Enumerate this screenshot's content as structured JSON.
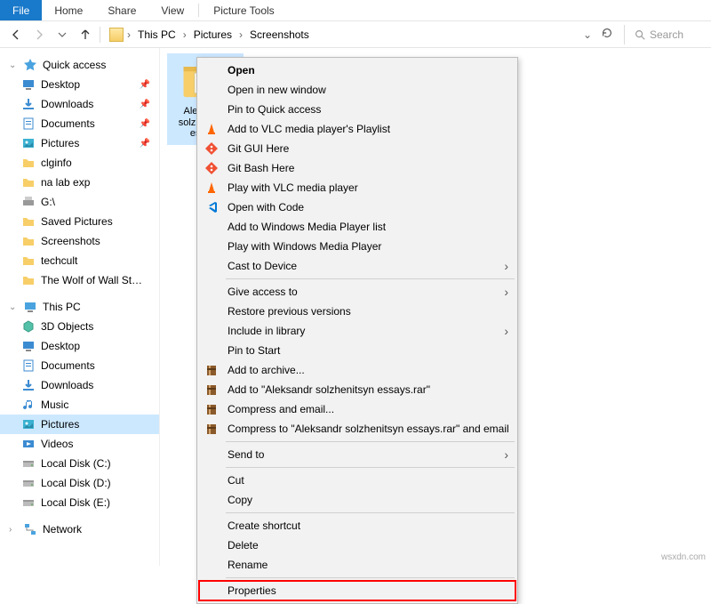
{
  "ribbon": {
    "file": "File",
    "home": "Home",
    "share": "Share",
    "view": "View",
    "tools": "Picture Tools"
  },
  "nav": {
    "crumbs": [
      "This PC",
      "Pictures",
      "Screenshots"
    ],
    "search_placeholder": "Search"
  },
  "sidebar": {
    "quick_access": "Quick access",
    "qa_items": [
      {
        "label": "Desktop",
        "icon": "desktop",
        "pinned": true
      },
      {
        "label": "Downloads",
        "icon": "downloads",
        "pinned": true
      },
      {
        "label": "Documents",
        "icon": "documents",
        "pinned": true
      },
      {
        "label": "Pictures",
        "icon": "pictures",
        "pinned": true
      },
      {
        "label": "clginfo",
        "icon": "folder",
        "pinned": false
      },
      {
        "label": "na lab exp",
        "icon": "folder",
        "pinned": false
      },
      {
        "label": "G:\\",
        "icon": "drive-removable",
        "pinned": false
      },
      {
        "label": "Saved Pictures",
        "icon": "folder",
        "pinned": false
      },
      {
        "label": "Screenshots",
        "icon": "folder",
        "pinned": false
      },
      {
        "label": "techcult",
        "icon": "folder",
        "pinned": false
      },
      {
        "label": "The Wolf of Wall St…",
        "icon": "folder",
        "pinned": false
      }
    ],
    "this_pc": "This PC",
    "pc_items": [
      {
        "label": "3D Objects",
        "icon": "3d"
      },
      {
        "label": "Desktop",
        "icon": "desktop"
      },
      {
        "label": "Documents",
        "icon": "documents"
      },
      {
        "label": "Downloads",
        "icon": "downloads"
      },
      {
        "label": "Music",
        "icon": "music"
      },
      {
        "label": "Pictures",
        "icon": "pictures",
        "selected": true
      },
      {
        "label": "Videos",
        "icon": "videos"
      },
      {
        "label": "Local Disk (C:)",
        "icon": "drive"
      },
      {
        "label": "Local Disk (D:)",
        "icon": "drive"
      },
      {
        "label": "Local Disk (E:)",
        "icon": "drive"
      }
    ],
    "network": "Network"
  },
  "content": {
    "selected_folder": "Aleksandr solzhenitsyn essays"
  },
  "context_menu": {
    "groups": [
      [
        {
          "label": "Open",
          "bold": true
        },
        {
          "label": "Open in new window"
        },
        {
          "label": "Pin to Quick access"
        },
        {
          "label": "Add to VLC media player's Playlist",
          "icon": "vlc"
        },
        {
          "label": "Git GUI Here",
          "icon": "git"
        },
        {
          "label": "Git Bash Here",
          "icon": "git"
        },
        {
          "label": "Play with VLC media player",
          "icon": "vlc"
        },
        {
          "label": "Open with Code",
          "icon": "vscode"
        },
        {
          "label": "Add to Windows Media Player list"
        },
        {
          "label": "Play with Windows Media Player"
        },
        {
          "label": "Cast to Device",
          "submenu": true
        }
      ],
      [
        {
          "label": "Give access to",
          "submenu": true
        },
        {
          "label": "Restore previous versions"
        },
        {
          "label": "Include in library",
          "submenu": true
        },
        {
          "label": "Pin to Start"
        },
        {
          "label": "Add to archive...",
          "icon": "rar"
        },
        {
          "label": "Add to \"Aleksandr solzhenitsyn essays.rar\"",
          "icon": "rar"
        },
        {
          "label": "Compress and email...",
          "icon": "rar"
        },
        {
          "label": "Compress to \"Aleksandr solzhenitsyn essays.rar\" and email",
          "icon": "rar"
        }
      ],
      [
        {
          "label": "Send to",
          "submenu": true
        }
      ],
      [
        {
          "label": "Cut"
        },
        {
          "label": "Copy"
        }
      ],
      [
        {
          "label": "Create shortcut"
        },
        {
          "label": "Delete"
        },
        {
          "label": "Rename"
        }
      ],
      [
        {
          "label": "Properties",
          "highlighted": true
        }
      ]
    ]
  },
  "watermark": "wsxdn.com"
}
